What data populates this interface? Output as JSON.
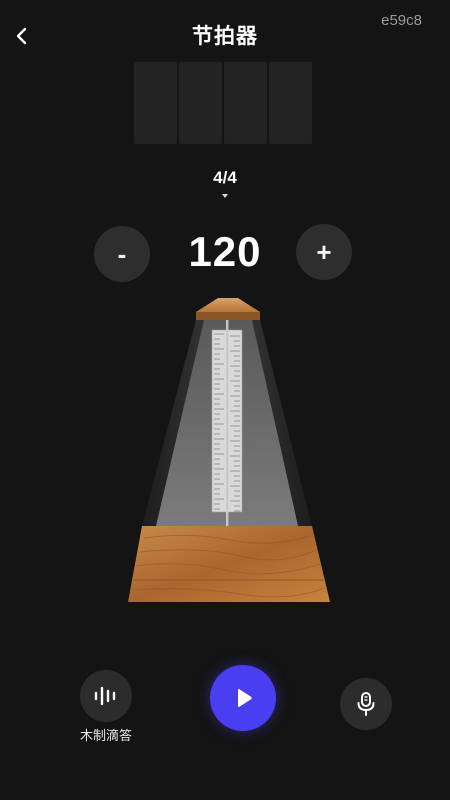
{
  "header": {
    "title": "节拍器",
    "back_icon": "chevron-left-icon",
    "watermark": "e59c8"
  },
  "beats": {
    "count": 4,
    "active": 0
  },
  "time_signature": {
    "label": "4/4"
  },
  "tempo": {
    "bpm": "120",
    "decrease_label": "-",
    "increase_label": "+"
  },
  "controls": {
    "sound_label": "木制滴答",
    "sound_icon": "sound-wave-icon",
    "play_icon": "play-icon",
    "mic_icon": "microphone-icon"
  },
  "colors": {
    "background": "#141414",
    "accent": "#4a3ff0",
    "button_bg": "#2e2e2e",
    "wood": "#b9773d"
  }
}
